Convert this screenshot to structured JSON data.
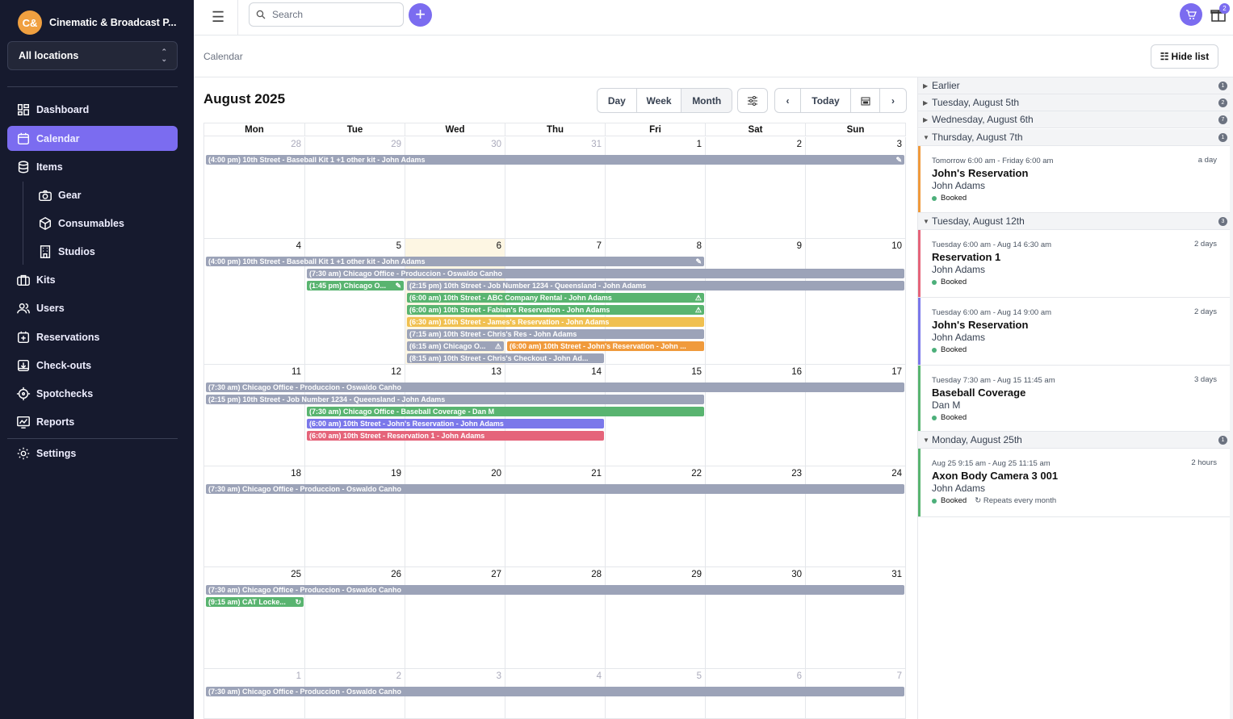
{
  "org": {
    "initials": "C&",
    "name": "Cinematic & Broadcast P..."
  },
  "location_select": {
    "value": "All locations"
  },
  "nav": {
    "dashboard": "Dashboard",
    "calendar": "Calendar",
    "items": "Items",
    "gear": "Gear",
    "consumables": "Consumables",
    "studios": "Studios",
    "kits": "Kits",
    "users": "Users",
    "reservations": "Reservations",
    "checkouts": "Check-outs",
    "spotchecks": "Spotchecks",
    "reports": "Reports",
    "settings": "Settings"
  },
  "search": {
    "placeholder": "Search"
  },
  "notifications": {
    "gift_count": "2"
  },
  "breadcrumb": "Calendar",
  "hide_list_label": "Hide list",
  "calendar": {
    "title": "August 2025",
    "views": [
      "Day",
      "Week",
      "Month"
    ],
    "selected_view": "Month",
    "today_label": "Today",
    "weekdays": [
      "Mon",
      "Tue",
      "Wed",
      "Thu",
      "Fri",
      "Sat",
      "Sun"
    ],
    "weeks": [
      [
        "28",
        "29",
        "30",
        "31",
        "1",
        "2",
        "3"
      ],
      [
        "4",
        "5",
        "6",
        "7",
        "8",
        "9",
        "10"
      ],
      [
        "11",
        "12",
        "13",
        "14",
        "15",
        "16",
        "17"
      ],
      [
        "18",
        "19",
        "20",
        "21",
        "22",
        "23",
        "24"
      ],
      [
        "25",
        "26",
        "27",
        "28",
        "29",
        "30",
        "31"
      ],
      [
        "1",
        "2",
        "3",
        "4",
        "5",
        "6",
        "7"
      ]
    ],
    "today": {
      "week": 1,
      "day": 2
    },
    "events": [
      {
        "week": 0,
        "start": 0,
        "span": 7,
        "row": 0,
        "color": "gray",
        "text": "(4:00 pm) 10th Street - Baseball Kit 1 +1 other kit - John Adams",
        "tag": "✎"
      },
      {
        "week": 1,
        "start": 0,
        "span": 5,
        "row": 0,
        "color": "gray",
        "text": "(4:00 pm) 10th Street - Baseball Kit 1 +1 other kit - John Adams",
        "tag": "✎"
      },
      {
        "week": 1,
        "start": 1,
        "span": 6,
        "row": 1,
        "color": "gray",
        "text": "(7:30 am) Chicago Office - Produccion - Oswaldo Canho"
      },
      {
        "week": 1,
        "start": 1,
        "span": 1,
        "row": 2,
        "color": "green",
        "text": "(1:45 pm) Chicago O...",
        "tag": "✎"
      },
      {
        "week": 1,
        "start": 2,
        "span": 5,
        "row": 2,
        "color": "gray",
        "text": "(2:15 pm) 10th Street - Job Number 1234 - Queensland - John Adams"
      },
      {
        "week": 1,
        "start": 2,
        "span": 3,
        "row": 3,
        "color": "green",
        "text": "(6:00 am) 10th Street - ABC Company Rental - John Adams",
        "tag": "⚠"
      },
      {
        "week": 1,
        "start": 2,
        "span": 3,
        "row": 4,
        "color": "green",
        "text": "(6:00 am) 10th Street - Fabian's Reservation - John Adams",
        "tag": "⚠"
      },
      {
        "week": 1,
        "start": 2,
        "span": 3,
        "row": 5,
        "color": "yellow",
        "text": "(6:30 am) 10th Street - James's Reservation - John Adams"
      },
      {
        "week": 1,
        "start": 2,
        "span": 3,
        "row": 6,
        "color": "gray",
        "text": "(7:15 am) 10th Street - Chris's Res - John Adams"
      },
      {
        "week": 1,
        "start": 2,
        "span": 1,
        "row": 7,
        "color": "gray",
        "text": "(6:15 am) Chicago O...",
        "tag": "⚠"
      },
      {
        "week": 1,
        "start": 3,
        "span": 2,
        "row": 7,
        "color": "orange",
        "text": "(6:00 am) 10th Street - John's Reservation - John ..."
      },
      {
        "week": 1,
        "start": 2,
        "span": 2,
        "row": 8,
        "color": "gray",
        "text": "(8:15 am) 10th Street - Chris's Checkout - John Ad..."
      },
      {
        "week": 2,
        "start": 0,
        "span": 7,
        "row": 0,
        "color": "gray",
        "text": "(7:30 am) Chicago Office - Produccion - Oswaldo Canho"
      },
      {
        "week": 2,
        "start": 0,
        "span": 5,
        "row": 1,
        "color": "gray",
        "text": "(2:15 pm) 10th Street - Job Number 1234 - Queensland - John Adams"
      },
      {
        "week": 2,
        "start": 1,
        "span": 4,
        "row": 2,
        "color": "green",
        "text": "(7:30 am) Chicago Office - Baseball Coverage - Dan M"
      },
      {
        "week": 2,
        "start": 1,
        "span": 3,
        "row": 3,
        "color": "blue",
        "text": "(6:00 am) 10th Street - John's Reservation - John Adams"
      },
      {
        "week": 2,
        "start": 1,
        "span": 3,
        "row": 4,
        "color": "red",
        "text": "(6:00 am) 10th Street - Reservation 1 - John Adams"
      },
      {
        "week": 3,
        "start": 0,
        "span": 7,
        "row": 0,
        "color": "gray",
        "text": "(7:30 am) Chicago Office - Produccion - Oswaldo Canho"
      },
      {
        "week": 4,
        "start": 0,
        "span": 7,
        "row": 0,
        "color": "gray",
        "text": "(7:30 am) Chicago Office - Produccion - Oswaldo Canho"
      },
      {
        "week": 4,
        "start": 0,
        "span": 1,
        "row": 1,
        "color": "green",
        "text": "(9:15 am) CAT Locke...",
        "tag": "↻"
      },
      {
        "week": 5,
        "start": 0,
        "span": 7,
        "row": 0,
        "color": "gray",
        "text": "(7:30 am) Chicago Office - Produccion - Oswaldo Canho"
      }
    ]
  },
  "list": {
    "groups": [
      {
        "label": "Earlier",
        "count": "1",
        "open": false
      },
      {
        "label": "Tuesday, August 5th",
        "count": "2",
        "open": false
      },
      {
        "label": "Wednesday, August 6th",
        "count": "7",
        "open": false
      },
      {
        "label": "Thursday, August 7th",
        "count": "1",
        "open": true
      },
      {
        "label": "Tuesday, August 12th",
        "count": "3",
        "open": true
      },
      {
        "label": "Monday, August 25th",
        "count": "1",
        "open": true
      }
    ],
    "items": [
      {
        "group": 3,
        "color": "#f09a3c",
        "dates": "Tomorrow 6:00 am - Friday 6:00 am",
        "duration": "a day",
        "title": "John's Reservation",
        "user": "John Adams",
        "status": "Booked",
        "repeat": ""
      },
      {
        "group": 4,
        "color": "#e5647a",
        "dates": "Tuesday 6:00 am - Aug 14 6:30 am",
        "duration": "2 days",
        "title": "Reservation 1",
        "user": "John Adams",
        "status": "Booked",
        "repeat": ""
      },
      {
        "group": 4,
        "color": "#7b78ea",
        "dates": "Tuesday 6:00 am - Aug 14 9:00 am",
        "duration": "2 days",
        "title": "John's Reservation",
        "user": "John Adams",
        "status": "Booked",
        "repeat": ""
      },
      {
        "group": 4,
        "color": "#59b470",
        "dates": "Tuesday 7:30 am - Aug 15 11:45 am",
        "duration": "3 days",
        "title": "Baseball Coverage",
        "user": "Dan M",
        "status": "Booked",
        "repeat": ""
      },
      {
        "group": 5,
        "color": "#59b470",
        "dates": "Aug 25 9:15 am - Aug 25 11:15 am",
        "duration": "2 hours",
        "title": "Axon Body Camera 3 001",
        "user": "John Adams",
        "status": "Booked",
        "repeat": "Repeats every month"
      }
    ]
  }
}
